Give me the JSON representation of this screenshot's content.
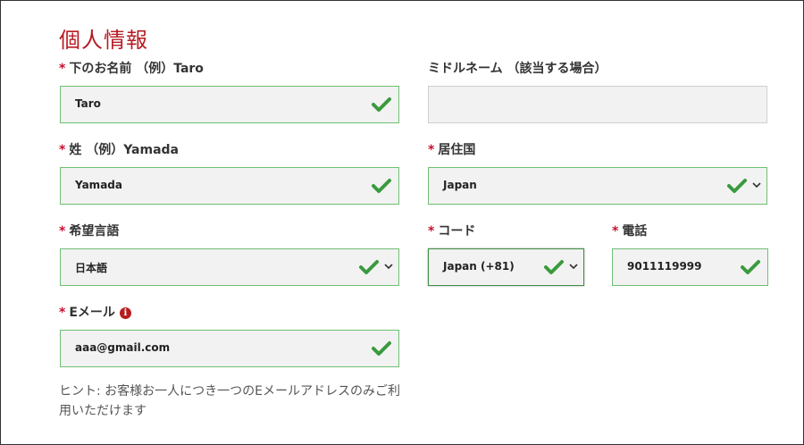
{
  "section_title": "個人情報",
  "required_mark": "*",
  "fields": {
    "first_name": {
      "label": "下のお名前 （例）Taro",
      "value": "Taro"
    },
    "middle_name": {
      "label": "ミドルネーム （該当する場合）",
      "value": ""
    },
    "last_name": {
      "label": "姓 （例）Yamada",
      "value": "Yamada"
    },
    "country": {
      "label": "居住国",
      "value": "Japan"
    },
    "language": {
      "label": "希望言語",
      "value": "日本語"
    },
    "code": {
      "label": "コード",
      "value": "Japan (+81)"
    },
    "phone": {
      "label": "電話",
      "value": "9011119999"
    },
    "email": {
      "label": "Eメール",
      "value": "aaa@gmail.com",
      "info_glyph": "i"
    }
  },
  "hint": "ヒント: お客様お一人につき一つのEメールアドレスのみご利用いただけます",
  "colors": {
    "title": "#b71c24",
    "required": "#c8102e",
    "valid_check": "#3a9a3e",
    "valid_border": "#6fbf73"
  },
  "icons": {
    "valid": "check-icon",
    "dropdown": "chevron-down-icon",
    "info": "info-icon"
  }
}
